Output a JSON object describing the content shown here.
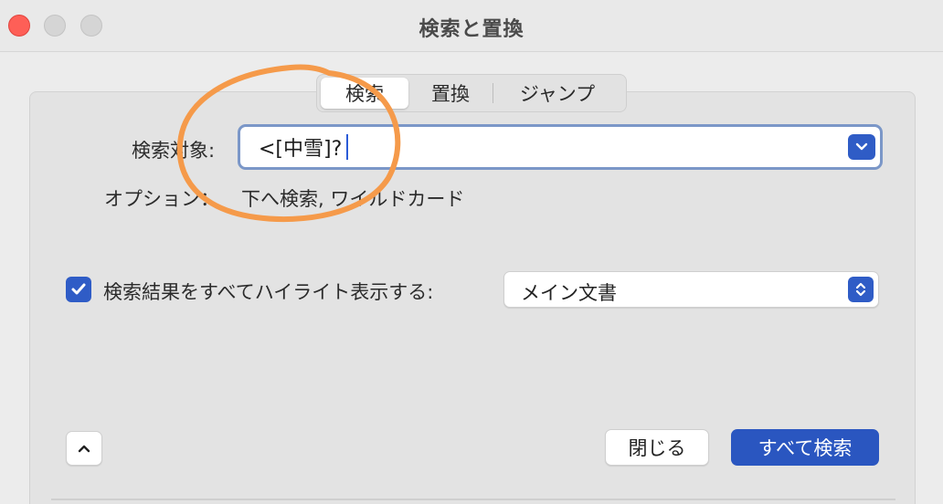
{
  "window": {
    "title": "検索と置換"
  },
  "tabs": [
    {
      "label": "検索",
      "selected": true
    },
    {
      "label": "置換",
      "selected": false
    },
    {
      "label": "ジャンプ",
      "selected": false
    }
  ],
  "search": {
    "label": "検索対象:",
    "value": "<[中雪]?"
  },
  "options": {
    "label": "オプション：",
    "value": "下へ検索, ワイルドカード"
  },
  "highlight": {
    "checked": true,
    "label": "検索結果をすべてハイライト表示する:",
    "selected_value": "メイン文書"
  },
  "buttons": {
    "close_label": "閉じる",
    "find_all_label": "すべて検索"
  },
  "colors": {
    "accent": "#2f5cc6",
    "annotation": "#f59a4a",
    "close_light": "#fe5f57"
  },
  "icons": {
    "combo_dropdown": "chevron-down-icon",
    "select_stepper": "up-down-chevron-icon",
    "disclosure": "chevron-up-icon",
    "checkbox": "checkmark-icon"
  }
}
